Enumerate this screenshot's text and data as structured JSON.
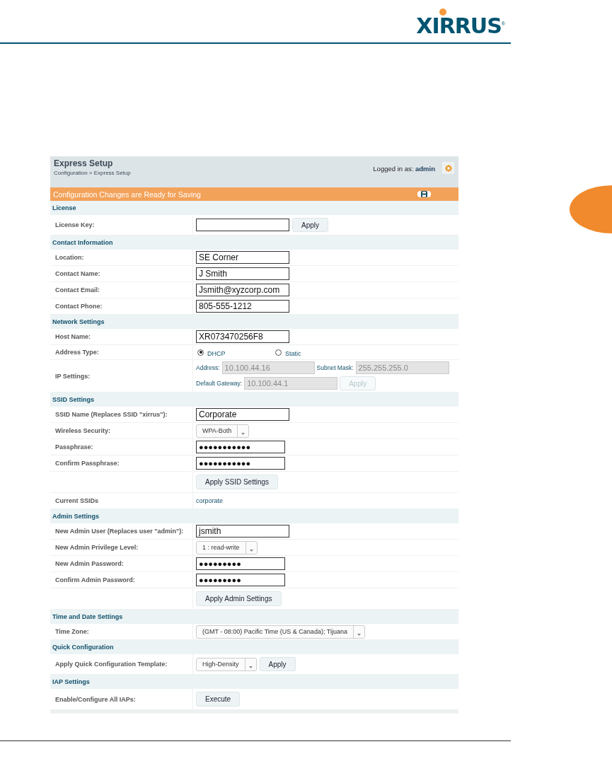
{
  "logo": {
    "text": "XIRRUS",
    "mark": "®"
  },
  "header": {
    "title": "Express Setup",
    "breadcrumb": "Configuration > Express Setup",
    "logged_in_label": "Logged in as:",
    "user": "admin"
  },
  "banner": {
    "text": "Configuration Changes are Ready for Saving"
  },
  "sections": [
    {
      "title": "License",
      "rows": [
        {
          "label": "License Key:",
          "kind": "field_button",
          "value": "",
          "button": "Apply"
        }
      ]
    },
    {
      "title": "Contact Information",
      "rows": [
        {
          "label": "Location:",
          "kind": "text",
          "value": "SE Corner"
        },
        {
          "label": "Contact Name:",
          "kind": "text",
          "value": "J Smith"
        },
        {
          "label": "Contact Email:",
          "kind": "text",
          "value": "Jsmith@xyzcorp.com"
        },
        {
          "label": "Contact Phone:",
          "kind": "text",
          "value": "805-555-1212"
        }
      ]
    },
    {
      "title": "Network Settings",
      "rows": [
        {
          "label": "Host Name:",
          "kind": "text",
          "value": "XR073470256F8"
        },
        {
          "label": "Address Type:",
          "kind": "radio",
          "options": [
            {
              "label": "DHCP",
              "selected": true
            },
            {
              "label": "Static",
              "selected": false
            }
          ]
        },
        {
          "label": "IP Settings:",
          "kind": "ip",
          "lines": [
            [
              {
                "label": "Address:",
                "value": "10.100.44.16",
                "disabled": true
              },
              {
                "label": "Subnet Mask:",
                "value": "255.255.255.0",
                "disabled": true
              }
            ],
            [
              {
                "label": "Default Gateway:",
                "value": "10.100.44.1",
                "disabled": true
              }
            ]
          ],
          "button": {
            "label": "Apply",
            "disabled": true
          }
        }
      ]
    },
    {
      "title": "SSID Settings",
      "rows": [
        {
          "label": "SSID Name (Replaces SSID \"xirrus\"):",
          "kind": "text",
          "value": "Corporate"
        },
        {
          "label": "Wireless Security:",
          "kind": "select",
          "value": "WPA-Both"
        },
        {
          "label": "Passphrase:",
          "kind": "password",
          "value": "●●●●●●●●●●●"
        },
        {
          "label": "Confirm Passphrase:",
          "kind": "password",
          "value": "●●●●●●●●●●●"
        },
        {
          "kind": "button",
          "button": "Apply SSID Settings"
        },
        {
          "label": "Current SSIDs",
          "kind": "static",
          "value": "corporate"
        }
      ]
    },
    {
      "title": "Admin Settings",
      "rows": [
        {
          "label": "New Admin User (Replaces user \"admin\"):",
          "kind": "text",
          "value": "jsmith"
        },
        {
          "label": "New Admin Privilege Level:",
          "kind": "select",
          "value": "1 : read-write"
        },
        {
          "label": "New Admin Password:",
          "kind": "password",
          "value": "●●●●●●●●●"
        },
        {
          "label": "Confirm Admin Password:",
          "kind": "password",
          "value": "●●●●●●●●●"
        },
        {
          "kind": "button",
          "button": "Apply Admin Settings"
        }
      ]
    },
    {
      "title": "Time and Date Settings",
      "rows": [
        {
          "label": "Time Zone:",
          "kind": "select",
          "value": "(GMT - 08:00) Pacific Time (US & Canada); Tijuana"
        }
      ]
    },
    {
      "title": "Quick Configuration",
      "rows": [
        {
          "label": "Apply Quick Configuration Template:",
          "kind": "select_button",
          "value": "High-Density",
          "button": "Apply"
        }
      ]
    },
    {
      "title": "IAP Settings",
      "rows": [
        {
          "label": "Enable/Configure All IAPs:",
          "kind": "button",
          "button": "Execute"
        }
      ]
    }
  ]
}
